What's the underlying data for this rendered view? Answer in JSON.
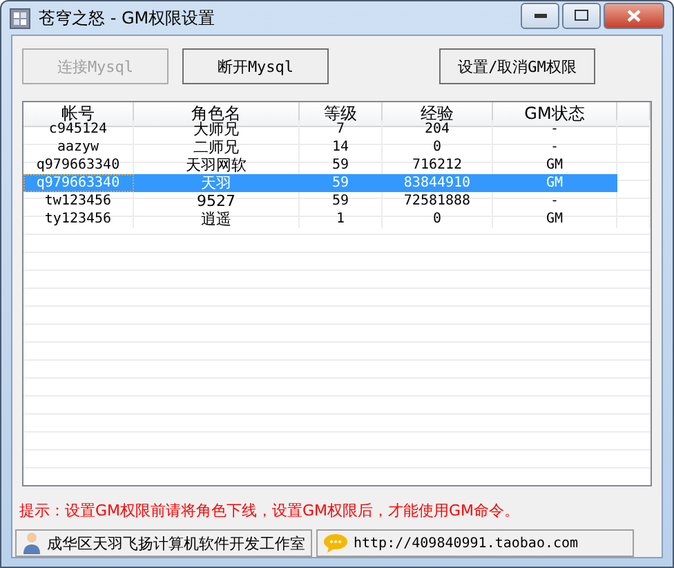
{
  "window": {
    "title": "苍穹之怒 - GM权限设置"
  },
  "toolbar": [
    {
      "label": "连接Mysql",
      "disabled": true
    },
    {
      "label": "断开Mysql",
      "disabled": false
    },
    {
      "label": "设置/取消GM权限",
      "disabled": false
    }
  ],
  "table": {
    "columns": [
      "帐号",
      "角色名",
      "等级",
      "经验",
      "GM状态"
    ],
    "rows": [
      {
        "cells": [
          "c945124",
          "大师兄",
          "7",
          "204",
          "-"
        ],
        "selected": false
      },
      {
        "cells": [
          "aazyw",
          "二师兄",
          "14",
          "0",
          "-"
        ],
        "selected": false
      },
      {
        "cells": [
          "q979663340",
          "天羽网软",
          "59",
          "716212",
          "GM"
        ],
        "selected": false
      },
      {
        "cells": [
          "q979663340",
          "天羽",
          "59",
          "83844910",
          "GM"
        ],
        "selected": true
      },
      {
        "cells": [
          "tw123456",
          "9527",
          "59",
          "72581888",
          "-"
        ],
        "selected": false
      },
      {
        "cells": [
          "ty123456",
          "逍遥",
          "1",
          "0",
          "GM"
        ],
        "selected": false
      }
    ]
  },
  "hint": "提示：设置GM权限前请将角色下线，设置GM权限后，才能使用GM命令。",
  "status_bar": [
    {
      "kind": "person",
      "text": "成华区天羽飞扬计算机软件开发工作室"
    },
    {
      "kind": "chat",
      "text": "http://409840991.taobao.com"
    }
  ]
}
